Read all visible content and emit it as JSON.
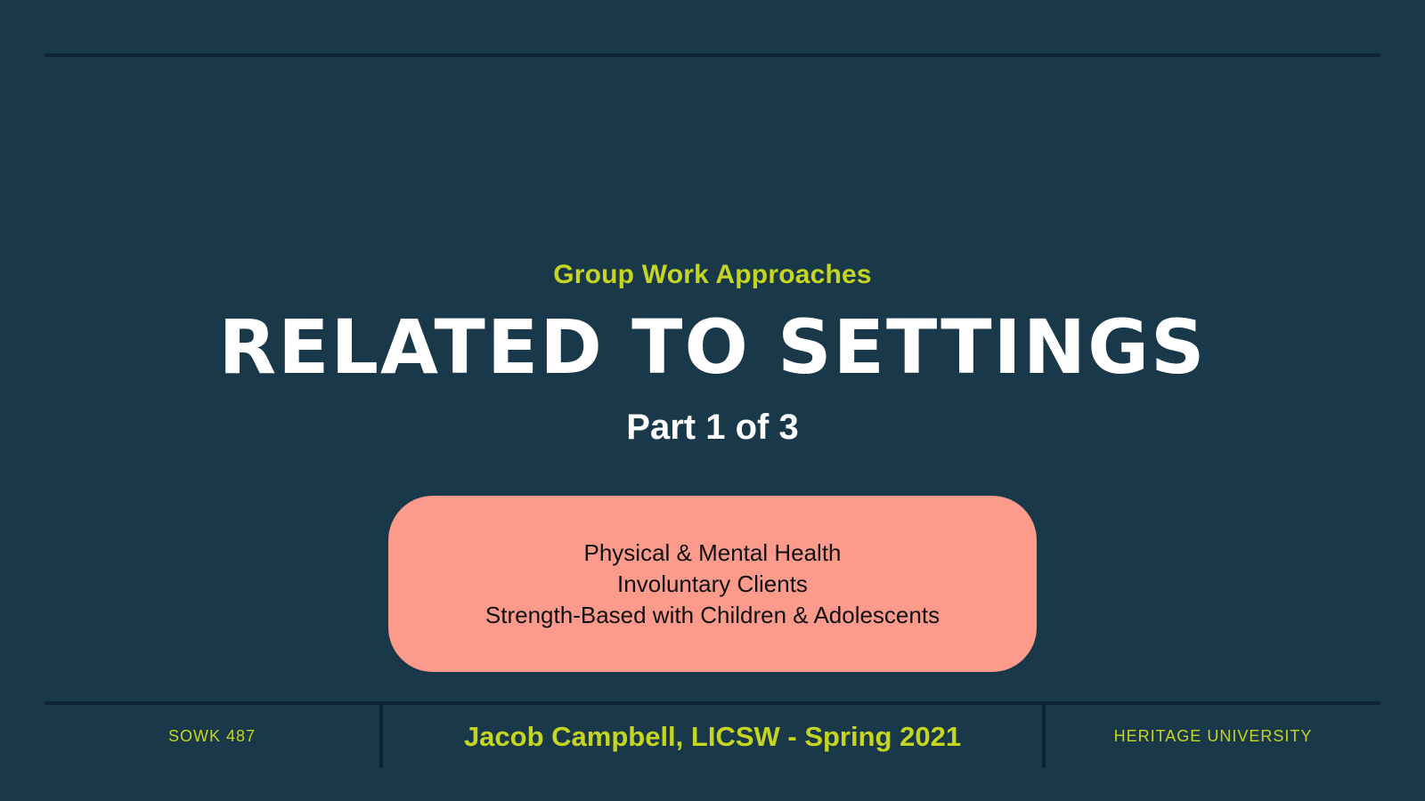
{
  "slide": {
    "subtitle": "Group Work Approaches",
    "title": "RELATED TO SETTINGS",
    "part": "Part 1 of 3",
    "topics": [
      "Physical & Mental Health",
      "Involuntary Clients",
      "Strength-Based with Children & Adolescents"
    ]
  },
  "footer": {
    "course": "SOWK 487",
    "presenter": "Jacob Campbell, LICSW - Spring 2021",
    "institution": "HERITAGE UNIVERSITY"
  },
  "colors": {
    "background": "#19384a",
    "accent": "#c6d620",
    "title": "#ffffff",
    "topics_box": "#fc9a8c",
    "rule": "#0b2333"
  }
}
